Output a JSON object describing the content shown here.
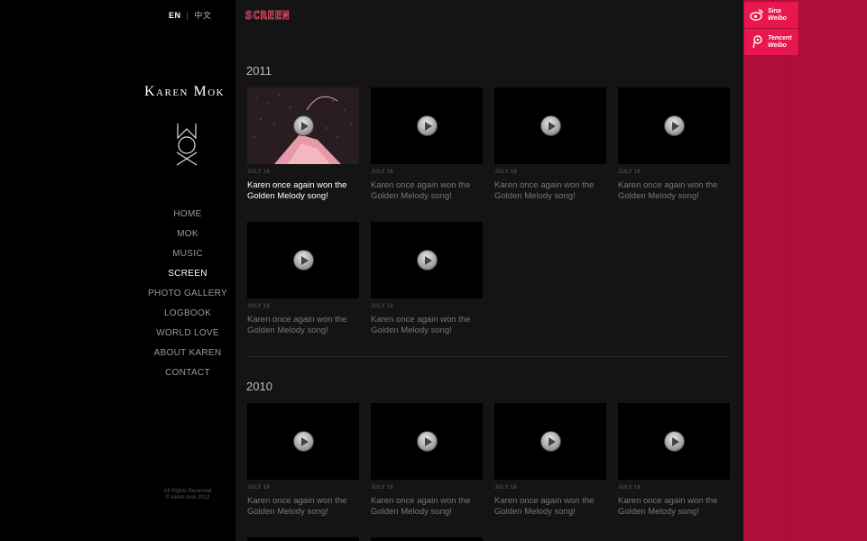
{
  "lang": {
    "en": "EN",
    "separator": "|",
    "zh": "中文"
  },
  "brand": {
    "name": "Karen Mok"
  },
  "nav": [
    {
      "label": "HOME",
      "active": false
    },
    {
      "label": "MOK",
      "active": false
    },
    {
      "label": "MUSIC",
      "active": false
    },
    {
      "label": "SCREEN",
      "active": true
    },
    {
      "label": "PHOTO GALLERY",
      "active": false
    },
    {
      "label": "LOGBOOK",
      "active": false
    },
    {
      "label": "WORLD LOVE",
      "active": false
    },
    {
      "label": "ABOUT KAREN",
      "active": false
    },
    {
      "label": "CONTACT",
      "active": false
    }
  ],
  "copyright": {
    "line1": "All Rights Reserved",
    "line2": "© karen mok 2012"
  },
  "section_title": "SCREEN",
  "sections": [
    {
      "year": "2011",
      "videos": [
        {
          "date": "JULY 16",
          "title": "Karen once again won the Golden Melody song!"
        },
        {
          "date": "JULY 16",
          "title": "Karen once again won the Golden Melody song!"
        },
        {
          "date": "JULY 16",
          "title": "Karen once again won the Golden Melody song!"
        },
        {
          "date": "JULY 16",
          "title": "Karen once again won the Golden Melody song!"
        },
        {
          "date": "JULY 16",
          "title": "Karen once again won the Golden Melody song!"
        },
        {
          "date": "JULY 16",
          "title": "Karen once again won the Golden Melody song!"
        }
      ]
    },
    {
      "year": "2010",
      "videos": [
        {
          "date": "JULY 16",
          "title": "Karen once again won the Golden Melody song!"
        },
        {
          "date": "JULY 16",
          "title": "Karen once again won the Golden Melody song!"
        },
        {
          "date": "JULY 16",
          "title": "Karen once again won the Golden Melody song!"
        },
        {
          "date": "JULY 16",
          "title": "Karen once again won the Golden Melody song!"
        }
      ]
    }
  ],
  "social": [
    {
      "line1": "Sina",
      "line2": "Weibo",
      "icon": "weibo-icon"
    },
    {
      "line1": "Tencent",
      "line2": "Weibo",
      "icon": "tencent-weibo-icon"
    }
  ],
  "colors": {
    "accent": "#e8174e",
    "background_red": "#b30f3b",
    "active_text": "#ffffff"
  }
}
